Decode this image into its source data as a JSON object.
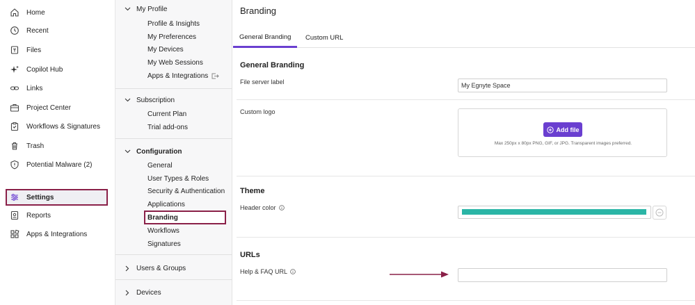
{
  "nav": {
    "items": [
      {
        "label": "Home",
        "icon": "home-icon"
      },
      {
        "label": "Recent",
        "icon": "clock-icon"
      },
      {
        "label": "Files",
        "icon": "files-icon"
      },
      {
        "label": "Copilot Hub",
        "icon": "sparkle-icon"
      },
      {
        "label": "Links",
        "icon": "link-icon"
      },
      {
        "label": "Project Center",
        "icon": "briefcase-icon"
      },
      {
        "label": "Workflows & Signatures",
        "icon": "clipboard-check-icon"
      },
      {
        "label": "Trash",
        "icon": "trash-icon"
      },
      {
        "label": "Potential Malware (2)",
        "icon": "shield-icon"
      },
      {
        "label": "Settings",
        "icon": "sliders-icon"
      },
      {
        "label": "Reports",
        "icon": "report-icon"
      },
      {
        "label": "Apps & Integrations",
        "icon": "apps-icon"
      }
    ],
    "active": "Settings"
  },
  "tree": {
    "my_profile": {
      "label": "My Profile",
      "items": [
        "Profile & Insights",
        "My Preferences",
        "My Devices",
        "My Web Sessions",
        "Apps & Integrations"
      ]
    },
    "subscription": {
      "label": "Subscription",
      "items": [
        "Current Plan",
        "Trial add-ons"
      ]
    },
    "configuration": {
      "label": "Configuration",
      "items": [
        "General",
        "User Types & Roles",
        "Security & Authentication",
        "Applications",
        "Branding",
        "Workflows",
        "Signatures"
      ]
    },
    "users_groups": {
      "label": "Users & Groups"
    },
    "devices": {
      "label": "Devices"
    },
    "active": "Branding"
  },
  "main": {
    "title": "Branding",
    "tabs": [
      {
        "label": "General Branding",
        "active": true
      },
      {
        "label": "Custom URL",
        "active": false
      }
    ],
    "general": {
      "title": "General Branding",
      "file_server_label": "File server label",
      "file_server_value": "My Egnyte Space",
      "custom_logo_label": "Custom logo",
      "add_file": "Add file",
      "upload_hint": "Max 250px x 80px PNG, GIF, or JPG. Transparent images preferred."
    },
    "theme": {
      "title": "Theme",
      "header_color_label": "Header color",
      "header_color": "#2bb5a6"
    },
    "urls": {
      "title": "URLs",
      "help_faq_label": "Help & FAQ URL",
      "help_faq_value": ""
    }
  },
  "colors": {
    "accent": "#6a3fd0",
    "highlight_border": "#8a2048",
    "annotation_arrow": "#8a2048"
  }
}
